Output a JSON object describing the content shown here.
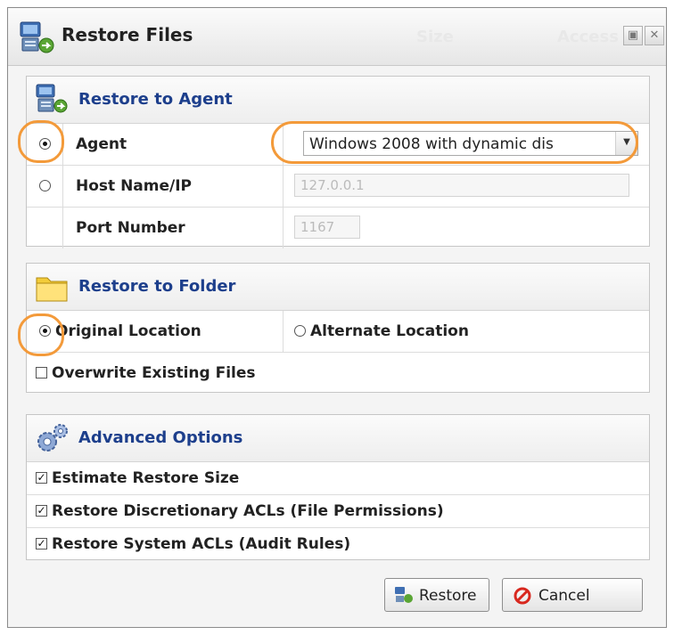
{
  "dialog": {
    "title": "Restore Files",
    "ghost_columns": [
      "Size",
      "Access"
    ]
  },
  "restore_agent": {
    "heading": "Restore to Agent",
    "agent_label": "Agent",
    "agent_value": "Windows 2008 with dynamic dis",
    "host_label": "Host Name/IP",
    "host_value": "127.0.0.1",
    "port_label": "Port Number",
    "port_value": "1167"
  },
  "restore_folder": {
    "heading": "Restore to Folder",
    "original_label": "Original Location",
    "alternate_label": "Alternate Location",
    "overwrite_label": "Overwrite Existing Files"
  },
  "advanced": {
    "heading": "Advanced Options",
    "estimate_label": "Estimate Restore Size",
    "dacl_label": "Restore Discretionary ACLs (File Permissions)",
    "sacl_label": "Restore System ACLs (Audit Rules)"
  },
  "buttons": {
    "restore": "Restore",
    "cancel": "Cancel"
  },
  "colors": {
    "heading_text": "#1d3f8c",
    "highlight_ring": "#f39a3a",
    "cancel_icon": "#d8281f"
  }
}
